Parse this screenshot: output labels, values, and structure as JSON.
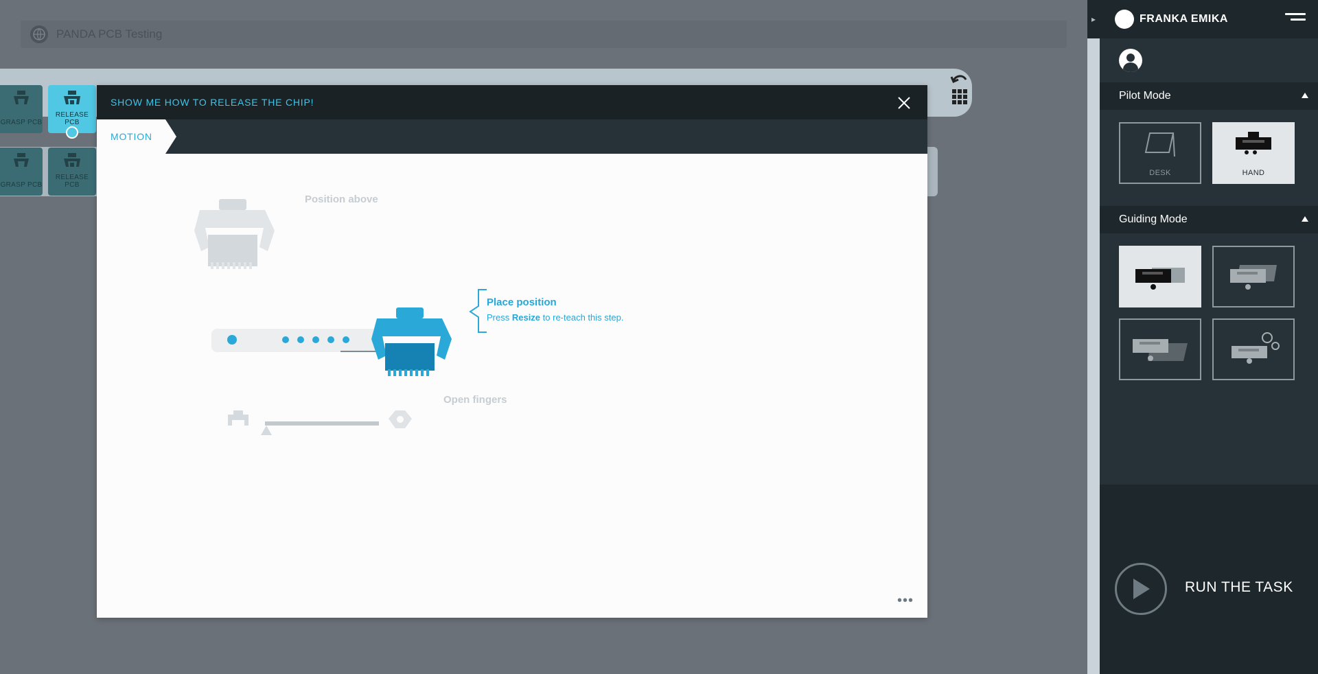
{
  "taskbar": {
    "title": "PANDA PCB Testing"
  },
  "timeline": {
    "row1": [
      {
        "label": "GRASP PCB",
        "icon": "gripper-icon"
      },
      {
        "label": "RELEASE PCB",
        "icon": "gripper-open-icon",
        "active": true
      }
    ],
    "row2": [
      {
        "label": "GRASP PCB",
        "icon": "gripper-icon"
      },
      {
        "label": "RELEASE PCB",
        "icon": "gripper-open-icon"
      }
    ]
  },
  "dialog": {
    "title": "SHOW ME HOW TO RELEASE THE CHIP!",
    "tab": "MOTION",
    "steps": {
      "position_above": "Position above",
      "place_title": "Place position",
      "place_prefix": "Press ",
      "place_key": "Resize",
      "place_suffix": " to re-teach this step.",
      "open_fingers": "Open fingers"
    },
    "more": "•••"
  },
  "sidebar": {
    "brand": "FRANKA EMIKA",
    "pilot_mode": {
      "title": "Pilot Mode",
      "tiles": [
        {
          "label": "DESK",
          "selected": false
        },
        {
          "label": "HAND",
          "selected": true
        }
      ]
    },
    "guiding_mode": {
      "title": "Guiding Mode",
      "tiles": [
        {
          "icon": "guiding-translation-icon",
          "selected": true
        },
        {
          "icon": "guiding-rotation-icon",
          "selected": false
        },
        {
          "icon": "guiding-free-icon",
          "selected": false
        },
        {
          "icon": "guiding-custom-icon",
          "selected": false
        }
      ]
    },
    "run_label": "RUN THE TASK"
  },
  "colors": {
    "accent": "#3ec5e9",
    "sidebar_bg": "#273238",
    "dialog_header": "#1a2226"
  }
}
